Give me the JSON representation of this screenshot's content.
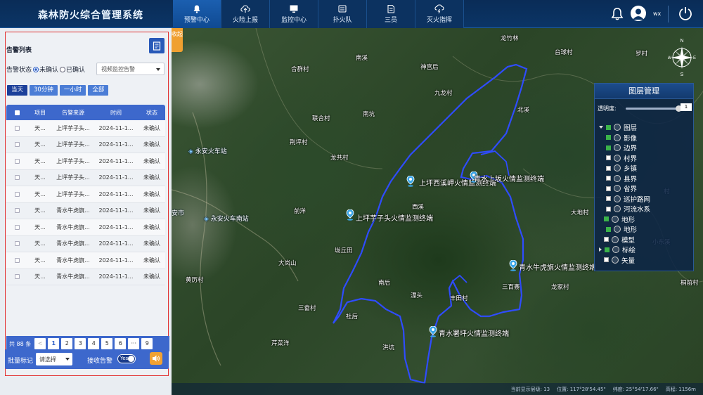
{
  "header": {
    "app_title": "森林防火综合管理系统",
    "nav": [
      {
        "label": "预警中心",
        "icon": "bell-icon",
        "active": true
      },
      {
        "label": "火险上报",
        "icon": "cloud-upload-icon",
        "active": false
      },
      {
        "label": "监控中心",
        "icon": "monitor-icon",
        "active": false
      },
      {
        "label": "扑火队",
        "icon": "team-icon",
        "active": false
      },
      {
        "label": "三员",
        "icon": "document-icon",
        "active": false
      },
      {
        "label": "灭火指挥",
        "icon": "cloud-lightning-icon",
        "active": false
      }
    ],
    "user_name": "wx"
  },
  "alert_panel": {
    "title": "告警列表",
    "status_label": "告警状态",
    "radio_unconfirmed": "未确认",
    "radio_confirmed": "已确认",
    "source_select": "视频监控告警",
    "time_tabs": [
      {
        "label": "当天",
        "active": true
      },
      {
        "label": "30分钟",
        "active": false
      },
      {
        "label": "一小时",
        "active": false
      },
      {
        "label": "全部",
        "active": false
      }
    ],
    "columns": {
      "item": "项目",
      "source": "告警来源",
      "time": "时间",
      "status": "状态"
    },
    "rows": [
      {
        "item": "天...",
        "source": "上坪芋子头...",
        "time": "2024-11-1...",
        "status": "未确认"
      },
      {
        "item": "天...",
        "source": "上坪芋子头...",
        "time": "2024-11-1...",
        "status": "未确认"
      },
      {
        "item": "天...",
        "source": "上坪芋子头...",
        "time": "2024-11-1...",
        "status": "未确认"
      },
      {
        "item": "天...",
        "source": "上坪芋子头...",
        "time": "2024-11-1...",
        "status": "未确认"
      },
      {
        "item": "天...",
        "source": "上坪芋子头...",
        "time": "2024-11-1...",
        "status": "未确认"
      },
      {
        "item": "天...",
        "source": "青水牛虎旗...",
        "time": "2024-11-1...",
        "status": "未确认"
      },
      {
        "item": "天...",
        "source": "青水牛虎旗...",
        "time": "2024-11-1...",
        "status": "未确认"
      },
      {
        "item": "天...",
        "source": "青水牛虎旗...",
        "time": "2024-11-1...",
        "status": "未确认"
      },
      {
        "item": "天...",
        "source": "青水牛虎旗...",
        "time": "2024-11-1...",
        "status": "未确认"
      },
      {
        "item": "天...",
        "source": "青水牛虎旗...",
        "time": "2024-11-1...",
        "status": "未确认"
      }
    ],
    "pager": {
      "total": "共 88 条",
      "prev": "<",
      "pages": [
        "1",
        "2",
        "3",
        "4",
        "5",
        "6",
        "···",
        "9"
      ],
      "current": "1"
    },
    "batch_label": "批量标记",
    "batch_select": "请选择",
    "receive_label": "接收告警",
    "toggle_text": "Yes"
  },
  "map": {
    "collapse_tab": "收起",
    "places": [
      {
        "name": "南溪"
      },
      {
        "name": "合群村"
      },
      {
        "name": "神宫后"
      },
      {
        "name": "九龙村"
      },
      {
        "name": "联合村"
      },
      {
        "name": "南坑"
      },
      {
        "name": "龙共村"
      },
      {
        "name": "荆坪村"
      },
      {
        "name": "前洋"
      },
      {
        "name": "西溪"
      },
      {
        "name": "垅丘田"
      },
      {
        "name": "大岚山"
      },
      {
        "name": "南后"
      },
      {
        "name": "漂头"
      },
      {
        "name": "丰田村"
      },
      {
        "name": "三畲村"
      },
      {
        "name": "社后"
      },
      {
        "name": "芹菜洋"
      },
      {
        "name": "洪坑"
      },
      {
        "name": "大地村"
      },
      {
        "name": "北溪"
      },
      {
        "name": "龙竹林"
      },
      {
        "name": "台球村"
      },
      {
        "name": "罗村"
      },
      {
        "name": "三百寨"
      },
      {
        "name": "龙家村"
      },
      {
        "name": "黄历村"
      },
      {
        "name": "桐前村"
      },
      {
        "name": "小东溪"
      },
      {
        "name": "村"
      }
    ],
    "towns": [
      {
        "name": "永安火车站"
      },
      {
        "name": "永安火车南站"
      },
      {
        "name": "安市"
      }
    ],
    "stations": [
      {
        "name": "上坪西溪岬火情监测终端"
      },
      {
        "name": "青水上坂火情监测终端"
      },
      {
        "name": "上坪芋子头火情监测终端"
      },
      {
        "name": "青水牛虎旗火情监测终端"
      },
      {
        "name": "青水署坪火情监测终端"
      }
    ],
    "compass_n": "N",
    "compass_s": "S",
    "compass_e": "E",
    "compass_w": "W",
    "status": {
      "zoom": "当前显示层级: 13",
      "location": "位置: 117°28'54.45\"",
      "lat": "纬度: 25°54'17.66\"",
      "altitude": "高程: 1156m"
    }
  },
  "layers": {
    "title": "图层管理",
    "opacity_label": "透明度:",
    "opacity_value": "1",
    "opacity_fraction": 1.0,
    "items": [
      {
        "label": "图层",
        "level": 0,
        "checked": true,
        "expand": "open"
      },
      {
        "label": "影像",
        "level": 1,
        "checked": true
      },
      {
        "label": "边界",
        "level": 1,
        "checked": true
      },
      {
        "label": "村界",
        "level": 1,
        "checked": false
      },
      {
        "label": "乡镇",
        "level": 1,
        "checked": false
      },
      {
        "label": "县界",
        "level": 1,
        "checked": false
      },
      {
        "label": "省界",
        "level": 1,
        "checked": false
      },
      {
        "label": "巡护路网",
        "level": 1,
        "checked": false
      },
      {
        "label": "河流水系",
        "level": 1,
        "checked": false
      },
      {
        "label": "地形",
        "level": 0,
        "checked": true,
        "expand": "none"
      },
      {
        "label": "地形",
        "level": 1,
        "checked": true
      },
      {
        "label": "模型",
        "level": 0,
        "checked": false,
        "expand": "none"
      },
      {
        "label": "标绘",
        "level": 0,
        "checked": true,
        "expand": "closed"
      },
      {
        "label": "矢量",
        "level": 0,
        "checked": false,
        "expand": "none"
      }
    ]
  },
  "colors": {
    "header_bg": "#0b3566",
    "nav_active": "#1b5fb0",
    "table_accent": "#3d68cc",
    "alert_border": "#e23030",
    "boundary_line": "#2f4cff",
    "pin": "#3aa6e8"
  }
}
